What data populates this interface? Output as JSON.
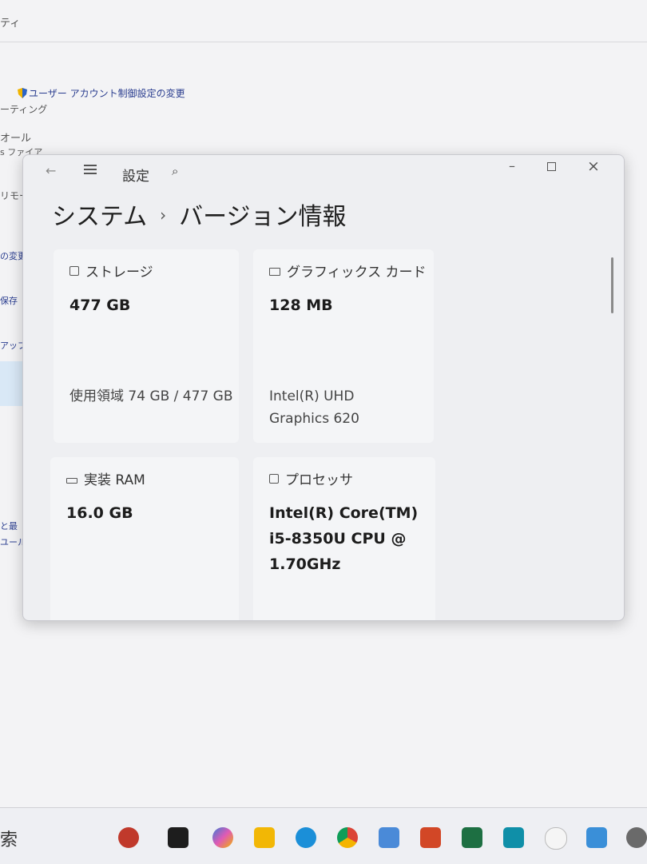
{
  "background": {
    "title_fragment": "ティ",
    "uac_link": "ユーザー アカウント制御設定の変更",
    "items": [
      "ーティング",
      "オール",
      "s ファイア",
      "リモー",
      "の変更",
      "保存",
      "アップ",
      "と最",
      "ユール"
    ]
  },
  "window": {
    "title": "設定",
    "breadcrumb": {
      "parent": "システム",
      "separator": "›",
      "current": "バージョン情報"
    },
    "cards": {
      "storage": {
        "heading": "ストレージ",
        "value": "477 GB",
        "sub": "使用領域 74 GB / 477 GB"
      },
      "graphics": {
        "heading": "グラフィックス カード",
        "value": "128 MB",
        "sub": "Intel(R) UHD Graphics 620"
      },
      "ram": {
        "heading": "実装 RAM",
        "value": "16.0 GB"
      },
      "processor": {
        "heading": "プロセッサ",
        "value": "Intel(R) Core(TM) i5-8350U CPU @ 1.70GHz"
      }
    }
  },
  "taskbar": {
    "search_fragment": "索",
    "icons": [
      "app-icon",
      "terminal-icon",
      "copilot-icon",
      "file-explorer-icon",
      "edge-icon",
      "chrome-icon",
      "photo-editor-icon",
      "powerpoint-icon",
      "excel-icon",
      "azure-icon",
      "itunes-icon",
      "remote-desktop-icon",
      "settings-icon"
    ]
  },
  "colors": {
    "accent": "#2a3d8f",
    "window_bg": "#eeeff2",
    "card_bg": "#f4f5f7"
  }
}
